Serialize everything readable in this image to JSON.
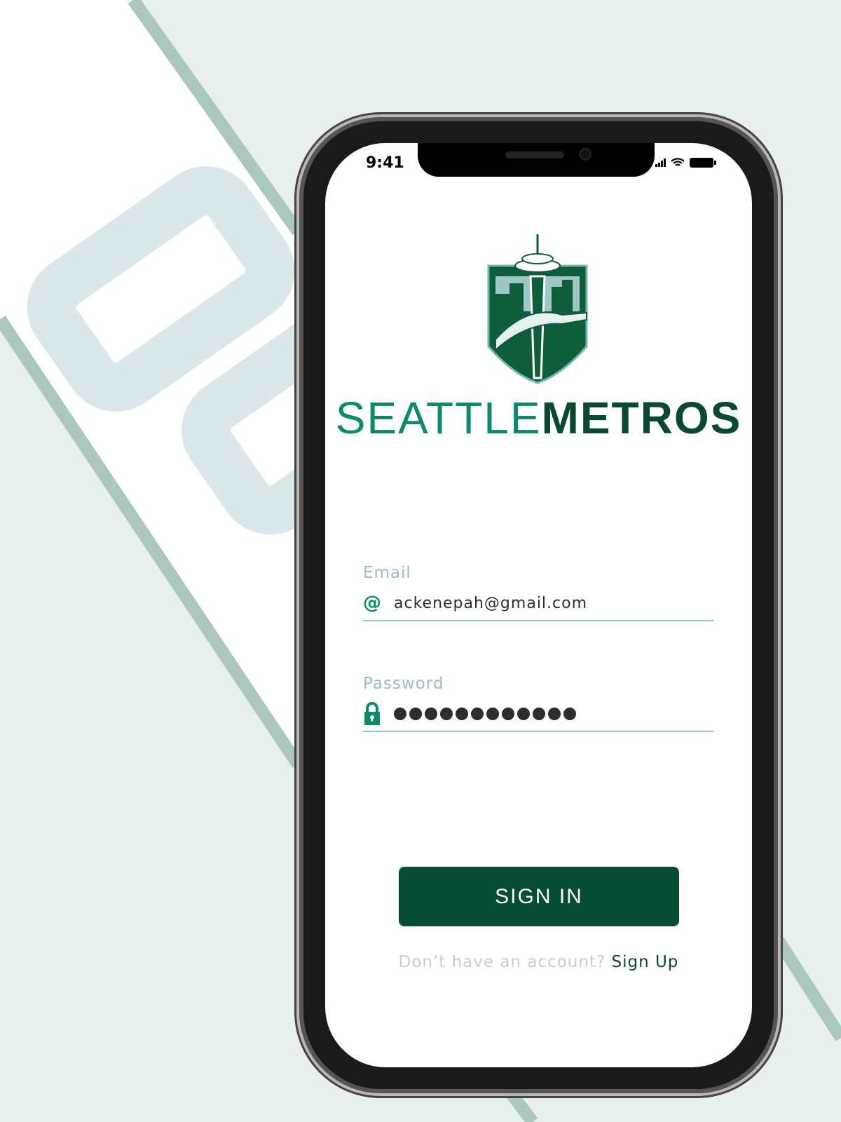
{
  "status_bar": {
    "time": "9:41"
  },
  "brand": {
    "part1": "SEATTLE",
    "part2": "METROS",
    "colors": {
      "light": "#0b8a6c",
      "dark": "#084a2e"
    }
  },
  "form": {
    "email_label": "Email",
    "email_value": "ackenepah@gmail.com",
    "email_icon": "at-icon",
    "password_label": "Password",
    "password_length": 12,
    "password_icon": "lock-icon",
    "submit_label": "SIGN IN"
  },
  "footer": {
    "prompt": "Don’t have an account?",
    "link": "Sign Up"
  }
}
